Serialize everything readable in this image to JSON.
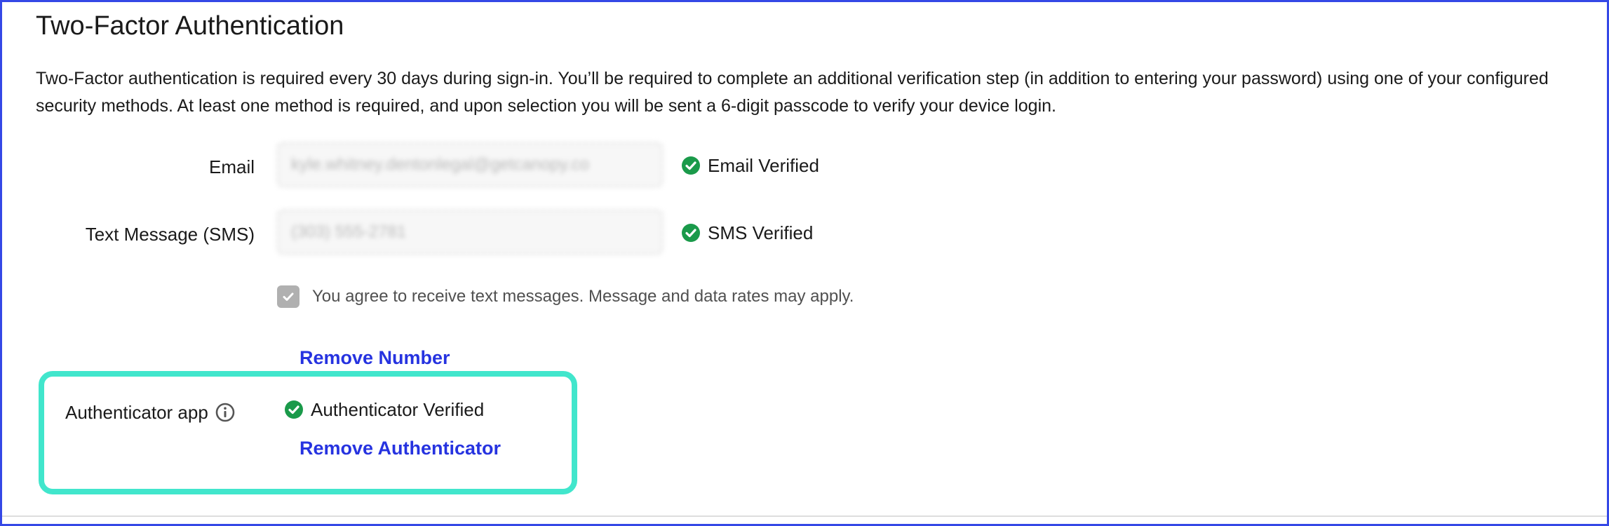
{
  "page": {
    "title": "Two-Factor Authentication",
    "description": "Two-Factor authentication is required every 30 days during sign-in. You’ll be required to complete an additional verification step (in addition to entering your password) using one of your configured security methods. At least one method is required, and upon selection you will be sent a 6-digit passcode to verify your device login."
  },
  "email": {
    "label": "Email",
    "value": "kyle.whitney.dentonlegal@getcanopy.co",
    "status_label": "Email Verified",
    "status_icon": "check-circle-icon"
  },
  "sms": {
    "label": "Text Message (SMS)",
    "value": "(303) 555-2781",
    "status_label": "SMS Verified",
    "status_icon": "check-circle-icon",
    "consent_checked": true,
    "consent_text": "You agree to receive text messages. Message and data rates may apply.",
    "remove_label": "Remove Number"
  },
  "authenticator": {
    "label": "Authenticator app",
    "info_icon": "info-icon",
    "status_label": "Authenticator Verified",
    "status_icon": "check-circle-icon",
    "remove_label": "Remove Authenticator"
  },
  "colors": {
    "frame": "#3548e6",
    "verified_green": "#1a9a4a",
    "link_blue": "#2633e0",
    "highlight": "#41e6cc",
    "checkbox_gray": "#b0b0b0"
  }
}
